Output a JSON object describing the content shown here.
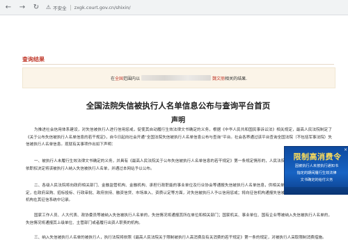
{
  "browser": {
    "security_label": "不安全",
    "url": "zxgk.court.gov.cn/shixin/"
  },
  "results": {
    "title": "查询结果",
    "banner_prefix": "在",
    "banner_scope": "全国",
    "banner_mid": "范围内以",
    "banner_end_name": "魏文丽",
    "banner_suffix": "相关的结果."
  },
  "document": {
    "title": "全国法院失信被执行人名单信息公布与查询平台首页",
    "subtitle": "声明",
    "paragraphs": [
      "为推进社会信用体系建设，对失信被执行人进行信用惩戒，促使其自动履行生效法律文书确定的义务，根据《中华人民共和国民事诉讼法》相关规定，最高人民法院制定了《关于公布失信被执行人名单信息的若干规定》，自今日起向社会开通“全国法院失信被执行人名单信息公布与查询”平台。社会各界通过该平台查询全国法院（不包括军事法院）失信被执行人名单信息。现就有关事项作出如下声明：",
      "一、被执行人未履行生效法律文书确定的义务，并具有《最高人民法院关于公布失信被执行人名单信息的若干规定》第一条规定情形的，人民法院将根据申请执行人的申请或依职权决定将该被执行人纳入失信被执行人名单，并通过本网站予以公布。",
      "二、各级人民法院将向政府相关部门、金融监管机构、金融机构、承担行政职能的事业单位及行业协会等通报失信被执行人名单信息，供相关单位依照法律、法规和有关规定，在政府采购、招标投标、行政审批、政府扶持、融资信贷、市场准入、资质认定等方面，对失信被执行人予以信用惩戒；将向征信机构通报失信被执行人名单信息，并由征信机构在其征信系统中记录。",
      "国家工作人员、人大代表、政协委员等被纳入失信被执行人名单的，失信情况将通报其所在单位和相关部门；国家机关、事业单位、国有企业等被纳入失信被执行人名单的，失信情况将通报其上级单位、主管部门或者履行出资人职责的机构。",
      "三、纳入失信被执行人名单的被执行人，执行法院将依照《最高人民法院关于限制被执行人高消费及有关消费的若干规定》第一条的规定，对被执行人采取限制消费措施。"
    ]
  },
  "ad": {
    "title": "限制高消费令",
    "line1": "因被执行人未按执行通知书",
    "line2": "指定的期间履行生效法律",
    "line3": "文书确定的给付义务",
    "close_glyph": "×"
  }
}
